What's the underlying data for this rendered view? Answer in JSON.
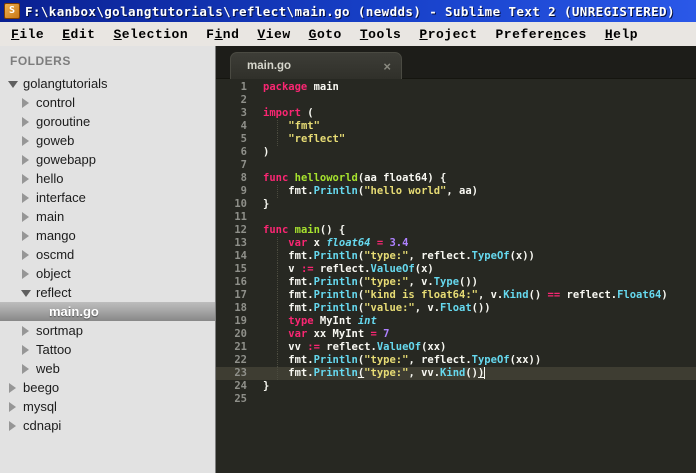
{
  "window": {
    "title": "F:\\kanbox\\golangtutorials\\reflect\\main.go (newdds) - Sublime Text 2 (UNREGISTERED)",
    "app_icon": "sublime-text-logo",
    "app_icon_letter": "S"
  },
  "menubar": {
    "items": [
      {
        "label": "File",
        "underline": 0
      },
      {
        "label": "Edit",
        "underline": 0
      },
      {
        "label": "Selection",
        "underline": 0
      },
      {
        "label": "Find",
        "underline": 1
      },
      {
        "label": "View",
        "underline": 0
      },
      {
        "label": "Goto",
        "underline": 0
      },
      {
        "label": "Tools",
        "underline": 0
      },
      {
        "label": "Project",
        "underline": 0
      },
      {
        "label": "Preferences",
        "underline": 7
      },
      {
        "label": "Help",
        "underline": 0
      }
    ]
  },
  "sidebar": {
    "header": "FOLDERS",
    "items": [
      {
        "label": "golangtutorials",
        "level": 0,
        "state": "expanded",
        "selected": false
      },
      {
        "label": "control",
        "level": 1,
        "state": "collapsed",
        "selected": false
      },
      {
        "label": "goroutine",
        "level": 1,
        "state": "collapsed",
        "selected": false
      },
      {
        "label": "goweb",
        "level": 1,
        "state": "collapsed",
        "selected": false
      },
      {
        "label": "gowebapp",
        "level": 1,
        "state": "collapsed",
        "selected": false
      },
      {
        "label": "hello",
        "level": 1,
        "state": "collapsed",
        "selected": false
      },
      {
        "label": "interface",
        "level": 1,
        "state": "collapsed",
        "selected": false
      },
      {
        "label": "main",
        "level": 1,
        "state": "collapsed",
        "selected": false
      },
      {
        "label": "mango",
        "level": 1,
        "state": "collapsed",
        "selected": false
      },
      {
        "label": "oscmd",
        "level": 1,
        "state": "collapsed",
        "selected": false
      },
      {
        "label": "object",
        "level": 1,
        "state": "collapsed",
        "selected": false
      },
      {
        "label": "reflect",
        "level": 1,
        "state": "expanded",
        "selected": false
      },
      {
        "label": "main.go",
        "level": 2,
        "state": "file",
        "selected": true
      },
      {
        "label": "sortmap",
        "level": 1,
        "state": "collapsed",
        "selected": false
      },
      {
        "label": "Tattoo",
        "level": 1,
        "state": "collapsed",
        "selected": false
      },
      {
        "label": "web",
        "level": 1,
        "state": "collapsed",
        "selected": false
      },
      {
        "label": "beego",
        "level": 0,
        "state": "collapsed",
        "selected": false
      },
      {
        "label": "mysql",
        "level": 0,
        "state": "collapsed",
        "selected": false
      },
      {
        "label": "cdnapi",
        "level": 0,
        "state": "collapsed",
        "selected": false
      }
    ]
  },
  "editor": {
    "tab": {
      "label": "main.go",
      "close_glyph": "×"
    },
    "colors": {
      "background": "#272822",
      "current_line": "#3e3d32",
      "gutter_text": "#8f908a",
      "keyword": "#f92672",
      "function_call": "#66d9ef",
      "type_italic": "#66d9ef",
      "function_name": "#a6e22e",
      "string": "#e6db74",
      "number": "#ae81ff",
      "plain": "#f8f8f2"
    },
    "lines": [
      {
        "n": 1,
        "t": [
          [
            "kw",
            "package"
          ],
          [
            "pl",
            " main"
          ]
        ]
      },
      {
        "n": 2,
        "t": []
      },
      {
        "n": 3,
        "t": [
          [
            "kw",
            "import"
          ],
          [
            "pl",
            " ("
          ]
        ]
      },
      {
        "n": 4,
        "t": [
          [
            "pl",
            "    "
          ],
          [
            "st",
            "\"fmt\""
          ]
        ]
      },
      {
        "n": 5,
        "t": [
          [
            "pl",
            "    "
          ],
          [
            "st",
            "\"reflect\""
          ]
        ]
      },
      {
        "n": 6,
        "t": [
          [
            "pl",
            ")"
          ]
        ]
      },
      {
        "n": 7,
        "t": []
      },
      {
        "n": 8,
        "t": [
          [
            "kw",
            "func"
          ],
          [
            "pl",
            " "
          ],
          [
            "nm",
            "helloworld"
          ],
          [
            "pl",
            "(aa float64) {"
          ]
        ]
      },
      {
        "n": 9,
        "t": [
          [
            "pl",
            "    fmt."
          ],
          [
            "fn",
            "Println"
          ],
          [
            "pl",
            "("
          ],
          [
            "st",
            "\"hello world\""
          ],
          [
            "pl",
            ", aa)"
          ]
        ]
      },
      {
        "n": 10,
        "t": [
          [
            "pl",
            "}"
          ]
        ]
      },
      {
        "n": 11,
        "t": []
      },
      {
        "n": 12,
        "t": [
          [
            "kw",
            "func"
          ],
          [
            "pl",
            " "
          ],
          [
            "nm",
            "main"
          ],
          [
            "pl",
            "() {"
          ]
        ]
      },
      {
        "n": 13,
        "t": [
          [
            "pl",
            "    "
          ],
          [
            "kw",
            "var"
          ],
          [
            "pl",
            " x "
          ],
          [
            "ty",
            "float64"
          ],
          [
            "pl",
            " "
          ],
          [
            "kw",
            "="
          ],
          [
            "pl",
            " "
          ],
          [
            "nu",
            "3.4"
          ]
        ]
      },
      {
        "n": 14,
        "t": [
          [
            "pl",
            "    fmt."
          ],
          [
            "fn",
            "Println"
          ],
          [
            "pl",
            "("
          ],
          [
            "st",
            "\"type:\""
          ],
          [
            "pl",
            ", reflect."
          ],
          [
            "fn",
            "TypeOf"
          ],
          [
            "pl",
            "(x))"
          ]
        ]
      },
      {
        "n": 15,
        "t": [
          [
            "pl",
            "    v "
          ],
          [
            "kw",
            ":="
          ],
          [
            "pl",
            " reflect."
          ],
          [
            "fn",
            "ValueOf"
          ],
          [
            "pl",
            "(x)"
          ]
        ]
      },
      {
        "n": 16,
        "t": [
          [
            "pl",
            "    fmt."
          ],
          [
            "fn",
            "Println"
          ],
          [
            "pl",
            "("
          ],
          [
            "st",
            "\"type:\""
          ],
          [
            "pl",
            ", v."
          ],
          [
            "fn",
            "Type"
          ],
          [
            "pl",
            "())"
          ]
        ]
      },
      {
        "n": 17,
        "t": [
          [
            "pl",
            "    fmt."
          ],
          [
            "fn",
            "Println"
          ],
          [
            "pl",
            "("
          ],
          [
            "st",
            "\"kind is float64:\""
          ],
          [
            "pl",
            ", v."
          ],
          [
            "fn",
            "Kind"
          ],
          [
            "pl",
            "() "
          ],
          [
            "kw",
            "=="
          ],
          [
            "pl",
            " reflect."
          ],
          [
            "fn",
            "Float64"
          ],
          [
            "pl",
            ")"
          ]
        ]
      },
      {
        "n": 18,
        "t": [
          [
            "pl",
            "    fmt."
          ],
          [
            "fn",
            "Println"
          ],
          [
            "pl",
            "("
          ],
          [
            "st",
            "\"value:\""
          ],
          [
            "pl",
            ", v."
          ],
          [
            "fn",
            "Float"
          ],
          [
            "pl",
            "())"
          ]
        ]
      },
      {
        "n": 19,
        "t": [
          [
            "pl",
            "    "
          ],
          [
            "kw",
            "type"
          ],
          [
            "pl",
            " MyInt "
          ],
          [
            "ty",
            "int"
          ]
        ]
      },
      {
        "n": 20,
        "t": [
          [
            "pl",
            "    "
          ],
          [
            "kw",
            "var"
          ],
          [
            "pl",
            " xx MyInt "
          ],
          [
            "kw",
            "="
          ],
          [
            "pl",
            " "
          ],
          [
            "nu",
            "7"
          ]
        ]
      },
      {
        "n": 21,
        "t": [
          [
            "pl",
            "    vv "
          ],
          [
            "kw",
            ":="
          ],
          [
            "pl",
            " reflect."
          ],
          [
            "fn",
            "ValueOf"
          ],
          [
            "pl",
            "(xx)"
          ]
        ]
      },
      {
        "n": 22,
        "t": [
          [
            "pl",
            "    fmt."
          ],
          [
            "fn",
            "Println"
          ],
          [
            "pl",
            "("
          ],
          [
            "st",
            "\"type:\""
          ],
          [
            "pl",
            ", reflect."
          ],
          [
            "fn",
            "TypeOf"
          ],
          [
            "pl",
            "(xx))"
          ]
        ]
      },
      {
        "n": 23,
        "cur": true,
        "t": [
          [
            "pl",
            "    fmt."
          ],
          [
            "fn",
            "Println"
          ],
          [
            "br",
            "("
          ],
          [
            "st",
            "\"type:\""
          ],
          [
            "pl",
            ", vv."
          ],
          [
            "fn",
            "Kind"
          ],
          [
            "pl",
            "()"
          ],
          [
            "br",
            ")"
          ],
          [
            "cr",
            ""
          ]
        ]
      },
      {
        "n": 24,
        "t": [
          [
            "pl",
            "}"
          ]
        ]
      },
      {
        "n": 25,
        "t": []
      }
    ]
  }
}
